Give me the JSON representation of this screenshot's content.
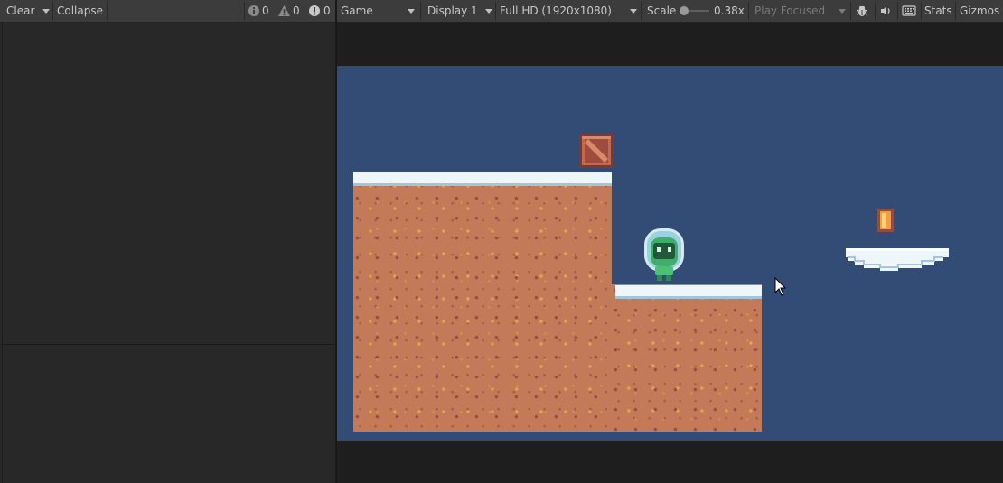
{
  "console": {
    "clear_label": "Clear",
    "collapse_label": "Collapse",
    "log_count": "0",
    "warning_count": "0",
    "error_count": "0"
  },
  "game_toolbar": {
    "view_label": "Game",
    "display_label": "Display 1",
    "resolution_label": "Full HD (1920x1080)",
    "scale_label": "Scale",
    "scale_value": "0.38x",
    "scale_fraction": 0.38,
    "play_mode_label": "Play Focused",
    "stats_label": "Stats",
    "gizmos_label": "Gizmos"
  },
  "icons": {
    "log": "info-icon",
    "warning": "warning-icon",
    "error": "error-icon",
    "bug": "bug-icon",
    "audio": "speaker-icon",
    "keyboard": "keyboard-icon",
    "cursor": "mouse-pointer-icon"
  },
  "colors": {
    "sky": "#324c76",
    "dirt": "#c27a58",
    "snow": "#eef6fa",
    "player_body": "#4cc078",
    "crate": "#b0604a",
    "coin": "#f0a040"
  }
}
